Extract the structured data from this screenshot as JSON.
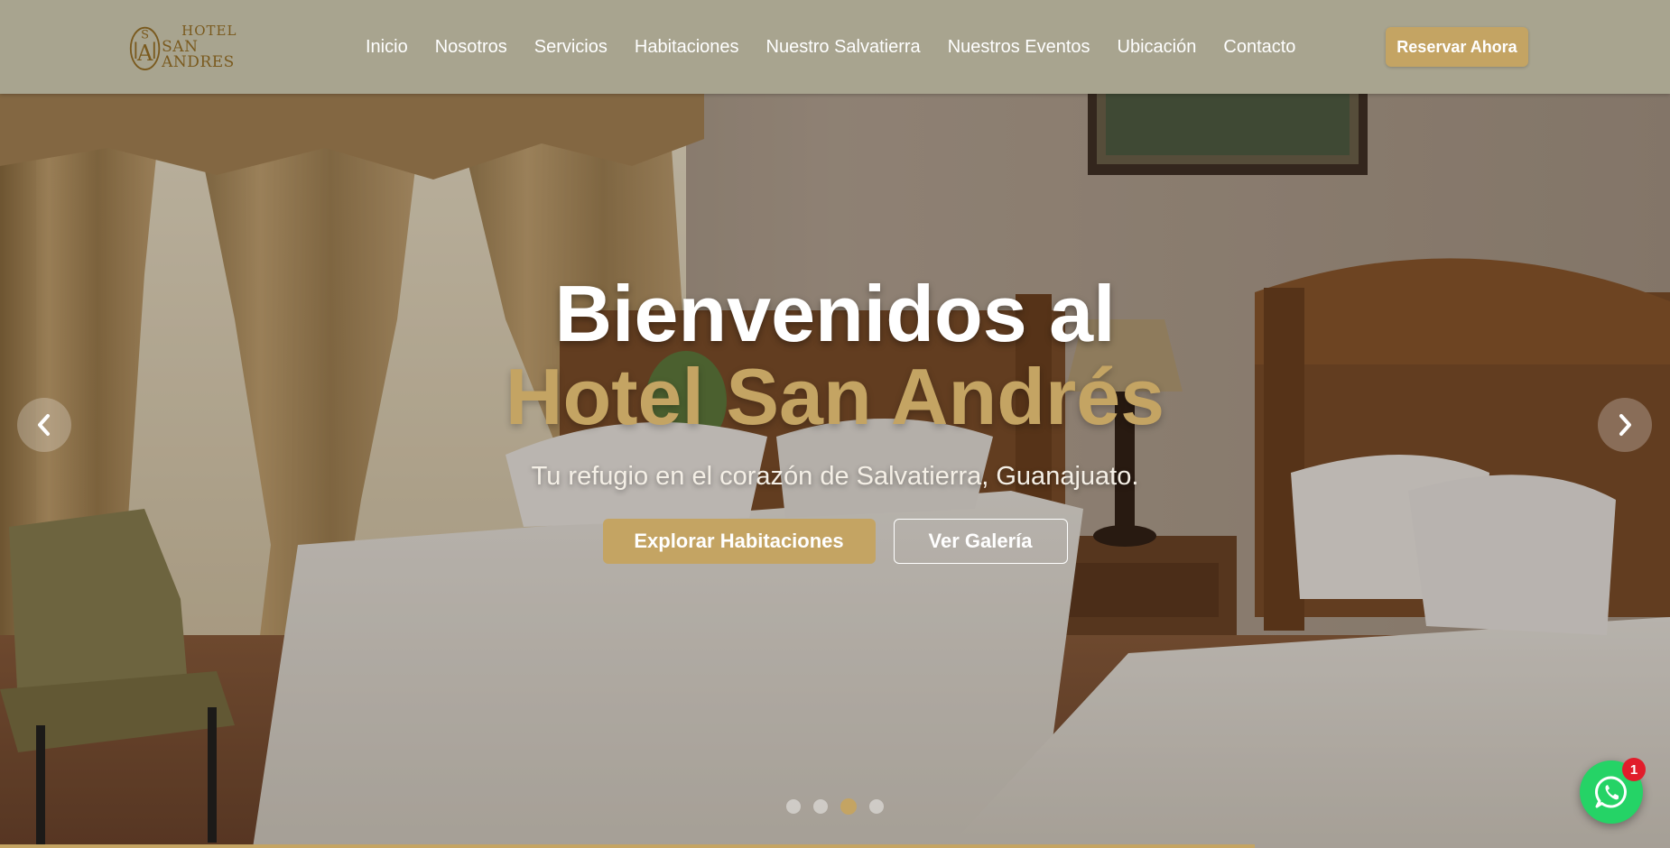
{
  "logo": {
    "line1": "HOTEL",
    "line2": "SAN ANDRES"
  },
  "nav": {
    "items": [
      {
        "label": "Inicio"
      },
      {
        "label": "Nosotros"
      },
      {
        "label": "Servicios"
      },
      {
        "label": "Habitaciones"
      },
      {
        "label": "Nuestro Salvatierra"
      },
      {
        "label": "Nuestros Eventos"
      },
      {
        "label": "Ubicación"
      },
      {
        "label": "Contacto"
      }
    ],
    "cta_label": "Reservar Ahora"
  },
  "hero": {
    "title_line1": "Bienvenidos al",
    "title_line2": "Hotel San Andrés",
    "subtitle": "Tu refugio en el corazón de Salvatierra, Guanajuato.",
    "primary_button": "Explorar Habitaciones",
    "secondary_button": "Ver Galería"
  },
  "carousel": {
    "slide_count": 4,
    "active_slide": 3
  },
  "whatsapp": {
    "badge_count": "1"
  },
  "colors": {
    "header_bg": "#a8a48f",
    "accent_gold": "#c4a463",
    "whatsapp_green": "#25d366",
    "badge_red": "#e11d2b"
  }
}
